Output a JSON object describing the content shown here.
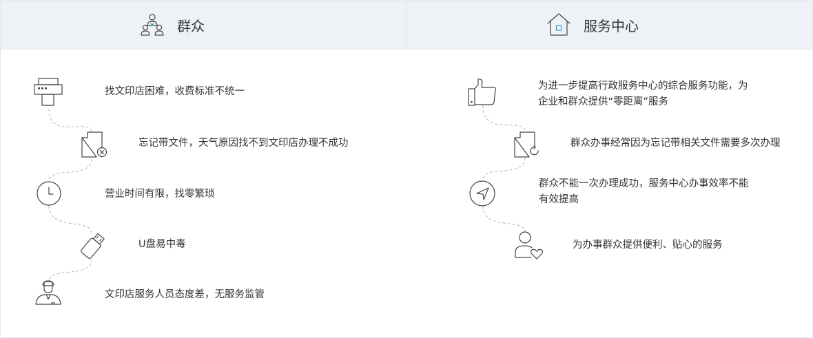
{
  "left_panel": {
    "title": "群众",
    "icon": "people-group-icon",
    "items": [
      {
        "text": "找文印店困难，收费标准不统一",
        "icon": "printer-icon"
      },
      {
        "text": "忘记带文件，天气原因找不到文印店办理不成功",
        "icon": "file-cancel-icon"
      },
      {
        "text": "营业时间有限，找零繁琐",
        "icon": "clock-icon"
      },
      {
        "text": "U盘易中毒",
        "icon": "usb-drive-icon"
      },
      {
        "text": "文印店服务人员态度差，无服务监管",
        "icon": "staff-icon"
      }
    ]
  },
  "right_panel": {
    "title": "服务中心",
    "icon": "home-icon",
    "items": [
      {
        "line1": "为进一步提高行政服务中心的综合服务功能，为",
        "line2": "企业和群众提供“零距离”服务",
        "icon": "thumbs-up-icon"
      },
      {
        "line1": "群众办事经常因为忘记带相关文件需要多次办理",
        "icon": "file-refresh-icon"
      },
      {
        "line1": "群众不能一次办理成功，服务中心办事效率不能",
        "line2": "有效提高",
        "icon": "navigation-icon"
      },
      {
        "line1": "为办事群众提供便利、贴心的服务",
        "icon": "user-heart-icon"
      }
    ]
  },
  "colors": {
    "header_bg": "#eef2f7",
    "accent": "#2f9ecf",
    "text": "#333333",
    "dash": "#b4b4b4"
  }
}
